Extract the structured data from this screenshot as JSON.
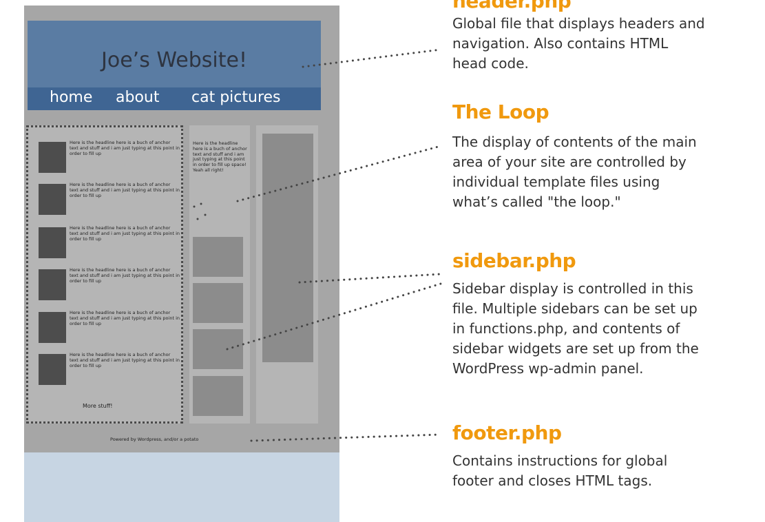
{
  "site": {
    "title": "Joe’s Website!",
    "nav": [
      "home",
      "about",
      "cat pictures"
    ],
    "posts": [
      "Here is the headline\nhere is a buch of anchor text and stuff and i am just typing at this point in order to fill up",
      "Here is the headline\nhere is a buch of anchor text and stuff and i am just typing at this point in order to fill up",
      "Here is the headline\nhere is a buch of anchor text and stuff and i am just typing at this point in order to fill up",
      "Here is the headline\nhere is a buch of anchor text and stuff and i am just typing at this point in order to fill up",
      "Here is the headline\nhere is a buch of anchor text and stuff and i am just typing at this point in order to fill up",
      "Here is the headline\nhere is a buch of anchor text and stuff and i am just typing at this point in order to fill up"
    ],
    "more": "More stuff!",
    "column_text": "Here is the headline\nhere is a buch of anchor text and stuff and i am just typing at this point in order to fill up space! Yeah all right!",
    "footer": "Powered by Wordpress, and/or a potato"
  },
  "annotations": {
    "header": {
      "label": "header.php",
      "desc": "Global file that displays headers and\nnavigation. Also contains HTML\nhead code."
    },
    "loop": {
      "label": "The Loop",
      "desc": "The display of contents of the main\narea of your site are controlled by\nindividual template files using\nwhat’s called \"the loop.\""
    },
    "sidebar": {
      "label": "sidebar.php",
      "desc": "Sidebar display is controlled in this\nfile. Multiple sidebars can be set up\nin functions.php, and contents of\nsidebar widgets are set up from the\nWordPress wp-admin panel."
    },
    "footer": {
      "label": "footer.php",
      "desc": "Contains instructions for global\nfooter and closes HTML tags."
    }
  },
  "colors": {
    "label": "#f0990e",
    "description": "#333333",
    "header": "#5a7ca3",
    "nav": "#3f6593",
    "mock_background": "#a6a6a6"
  }
}
